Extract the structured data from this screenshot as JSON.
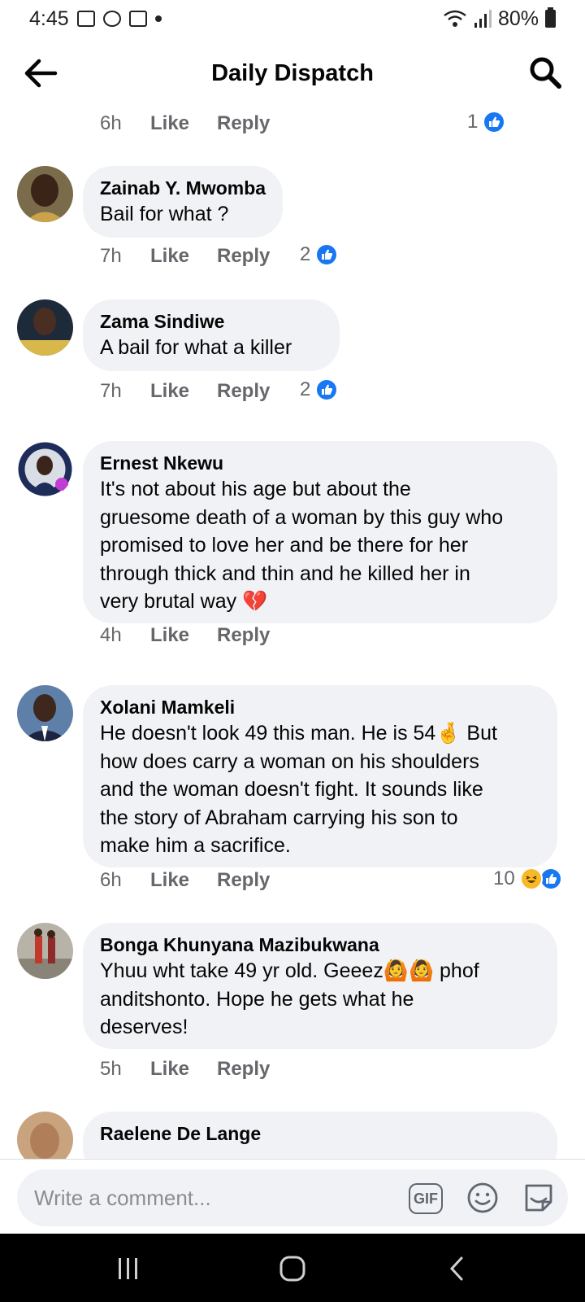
{
  "status_bar": {
    "time": "4:45",
    "battery": "80%"
  },
  "header": {
    "title": "Daily Dispatch"
  },
  "top_meta": {
    "time": "6h",
    "like": "Like",
    "reply": "Reply",
    "reaction_count": "1"
  },
  "comments": [
    {
      "author": "Zainab Y. Mwomba",
      "lines": [
        "Bail for what ?"
      ],
      "time": "7h",
      "like": "Like",
      "reply": "Reply",
      "reaction_count": "2"
    },
    {
      "author": "Zama Sindiwe",
      "lines": [
        "A bail for what a killer"
      ],
      "time": "7h",
      "like": "Like",
      "reply": "Reply",
      "reaction_count": "2"
    },
    {
      "author": "Ernest Nkewu",
      "lines": [
        "It's not about his age but about the",
        "gruesome death of a woman by this guy who",
        "promised to love her and be there for her",
        "through thick and thin and he killed her in",
        "very brutal way 💔"
      ],
      "time": "4h",
      "like": "Like",
      "reply": "Reply"
    },
    {
      "author": "Xolani Mamkeli",
      "lines": [
        "He doesn't look 49 this man. He is 54🤞 But",
        "how does carry a woman on his shoulders",
        "and the woman doesn't fight. It sounds like",
        "the story of Abraham carrying his son to",
        "make him a sacrifice."
      ],
      "time": "6h",
      "like": "Like",
      "reply": "Reply",
      "reaction_count": "10"
    },
    {
      "author": "Bonga Khunyana Mazibukwana",
      "lines": [
        "Yhuu  wht take 49 yr old. Geeez🙆🙆 phof",
        "anditshonto. Hope he gets what he",
        "deserves!"
      ],
      "time": "5h",
      "like": "Like",
      "reply": "Reply"
    },
    {
      "author": "Raelene De Lange",
      "lines": []
    }
  ],
  "composer": {
    "placeholder": "Write a comment...",
    "gif_label": "GIF"
  },
  "colors": {
    "accent": "#1877f2",
    "bubble": "#f0f2f5",
    "meta": "#65676b"
  },
  "icons": [
    "back-arrow-icon",
    "search-icon",
    "like-icon",
    "haha-icon",
    "gif-icon",
    "emoji-icon",
    "sticker-icon"
  ]
}
